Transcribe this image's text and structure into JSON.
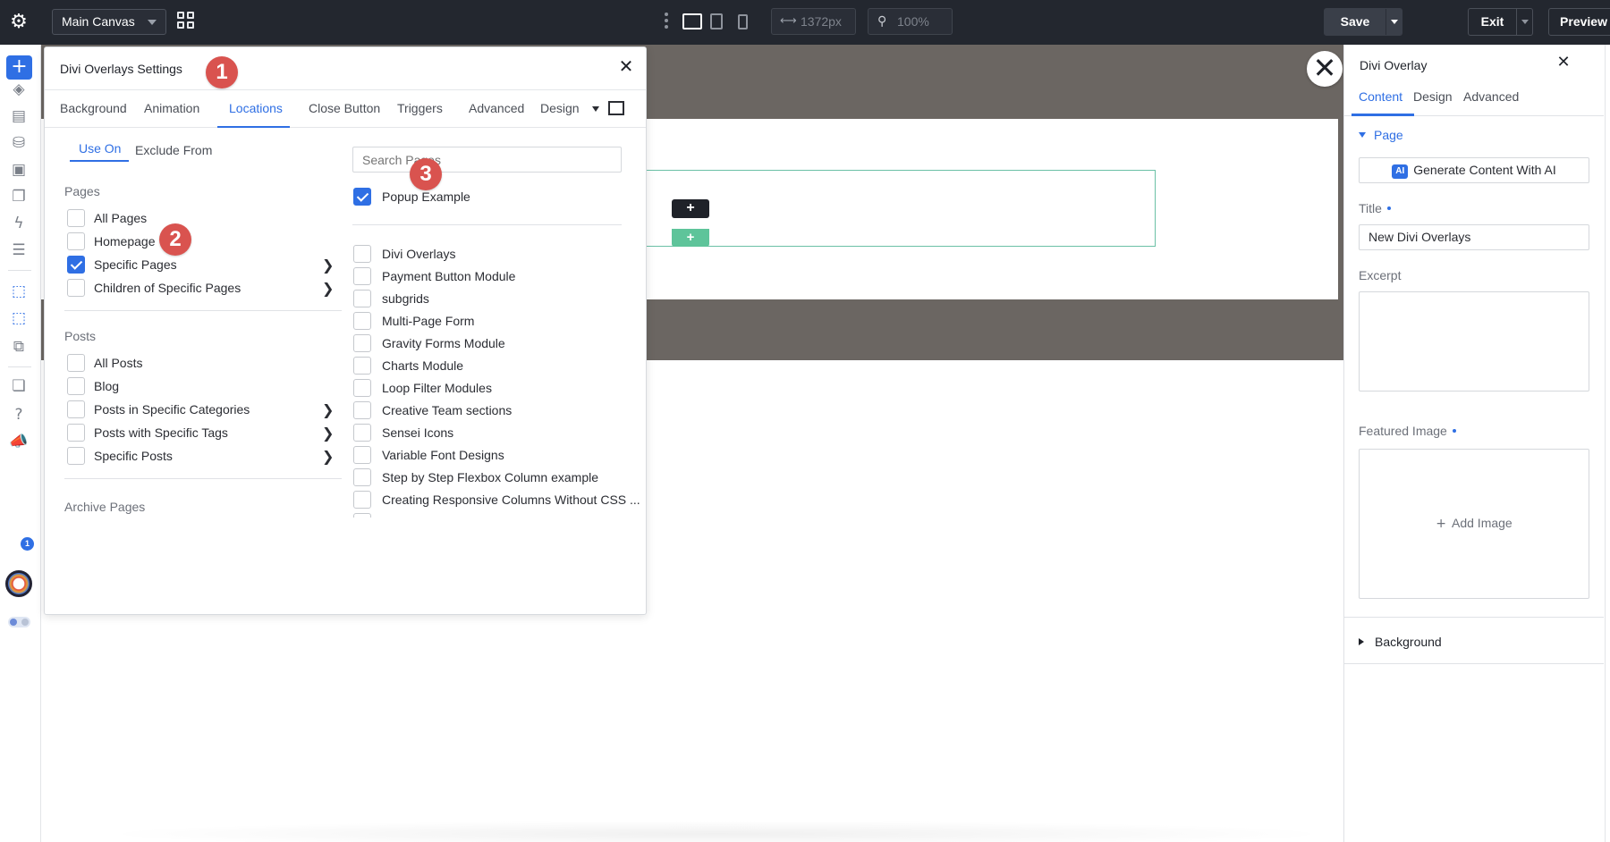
{
  "topbar": {
    "canvas_select": "Main Canvas",
    "width_value": "1372px",
    "zoom_value": "100%",
    "exit_label": "Exit",
    "preview_label": "Preview",
    "save_label": "Save"
  },
  "modal": {
    "title": "Divi Overlays Settings",
    "tabs": [
      "Background",
      "Animation",
      "Locations",
      "Close Button",
      "Triggers",
      "Advanced",
      "Design"
    ],
    "active_tab": "Locations",
    "subtabs": [
      "Use On",
      "Exclude From"
    ],
    "pages_label": "Pages",
    "pages": [
      {
        "label": "All Pages",
        "checked": false
      },
      {
        "label": "Homepage",
        "checked": false
      },
      {
        "label": "Specific Pages",
        "checked": true
      },
      {
        "label": "Children of Specific Pages",
        "checked": false
      }
    ],
    "posts_label": "Posts",
    "posts": [
      {
        "label": "All Posts",
        "checked": false
      },
      {
        "label": "Blog",
        "checked": false
      },
      {
        "label": "Posts in Specific Categories",
        "checked": false
      },
      {
        "label": "Posts with Specific Tags",
        "checked": false
      },
      {
        "label": "Specific Posts",
        "checked": false
      }
    ],
    "archive_label": "Archive Pages",
    "search_placeholder": "Search Pages",
    "selected_page": "Popup Example",
    "page_list": [
      "Divi Overlays",
      "Payment Button Module",
      "subgrids",
      "Multi-Page Form",
      "Gravity Forms Module",
      "Charts Module",
      "Loop Filter Modules",
      "Creative Team sections",
      "Sensei Icons",
      "Variable Font Designs",
      "Step by Step Flexbox Column example",
      "Creating Responsive Columns Without CSS ..."
    ],
    "markers": [
      "1",
      "2",
      "3"
    ]
  },
  "right_panel": {
    "title": "Divi Overlay",
    "tabs": [
      "Content",
      "Design",
      "Advanced"
    ],
    "page_group": "Page",
    "ai_badge": "AI",
    "ai_button": "Generate Content With AI",
    "title_label": "Title",
    "title_value": "New Divi Overlays",
    "excerpt_label": "Excerpt",
    "featured_label": "Featured Image",
    "add_image": "Add Image",
    "background_group": "Background"
  },
  "sidebar": {
    "notification_count": "1"
  },
  "colors": {
    "accent": "#2f6fe4",
    "topbar": "#23272f",
    "marker": "#d9534f",
    "section": "#6b6662",
    "row_outline": "#6bc0a6"
  }
}
